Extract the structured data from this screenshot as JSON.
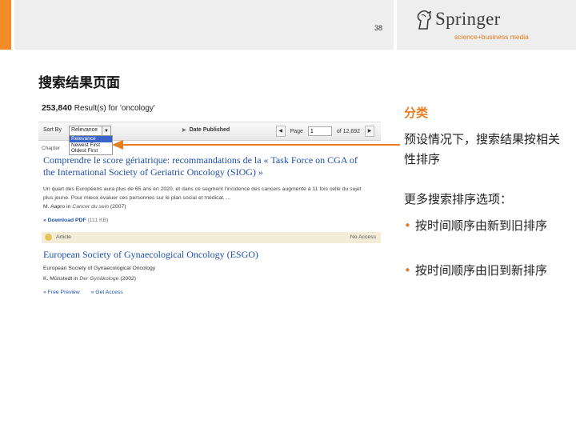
{
  "header": {
    "page_number": "38"
  },
  "logo": {
    "name": "Springer",
    "tagline": "science+business media"
  },
  "slide": {
    "title": "搜索结果页面"
  },
  "screenshot": {
    "results_count": "253,840",
    "results_text": "Result(s) for 'oncology'",
    "sort_label": "Sort By",
    "sort_selected": "Relevance",
    "sort_options": [
      "Relevance",
      "Newest First",
      "Oldest First"
    ],
    "date_published": "Date Published",
    "page_label": "Page",
    "page_value": "1",
    "page_of": "of 12,692",
    "chapter_label": "Chapter",
    "result1": {
      "title": "Comprendre le score gériatrique: recommandations de la « Task Force on CGA of the International Society of Geriatric Oncology (SIOG) »",
      "snippet": "Un quart des Européens aura plus de 65 ans en 2020, et dans ce segment l'incidence des cancers augmente à 11 fois celle du sujet plus jeune. Pour mieux évaluer ces personnes sur le plan social et médical, ...",
      "author": "M. Aapro",
      "in": "in",
      "journal": "Cancer du sein",
      "year": "(2007)",
      "download": "» Download PDF",
      "download_size": "(111 KB)"
    },
    "article_label": "Article",
    "access_label": "No Access",
    "result2": {
      "title": "European Society of Gynaecological Oncology (ESGO)",
      "organization": "European Society of Gynaecological Oncology",
      "author": "K. Münstedt",
      "in": "in",
      "journal": "Der Gynäkologe",
      "year": "(2002)",
      "preview": "» Free Preview",
      "get_access": "» Get Access"
    }
  },
  "sidebar": {
    "heading": "分类",
    "description": "预设情况下，搜索结果按相关性排序",
    "more_title": "更多搜索排序选项：",
    "bullets": [
      "按时间顺序由新到旧排序",
      "按时间顺序由旧到新排序"
    ]
  },
  "colors": {
    "accent": "#f28c28",
    "link": "#1f4fa8",
    "heading": "#e67e22"
  }
}
